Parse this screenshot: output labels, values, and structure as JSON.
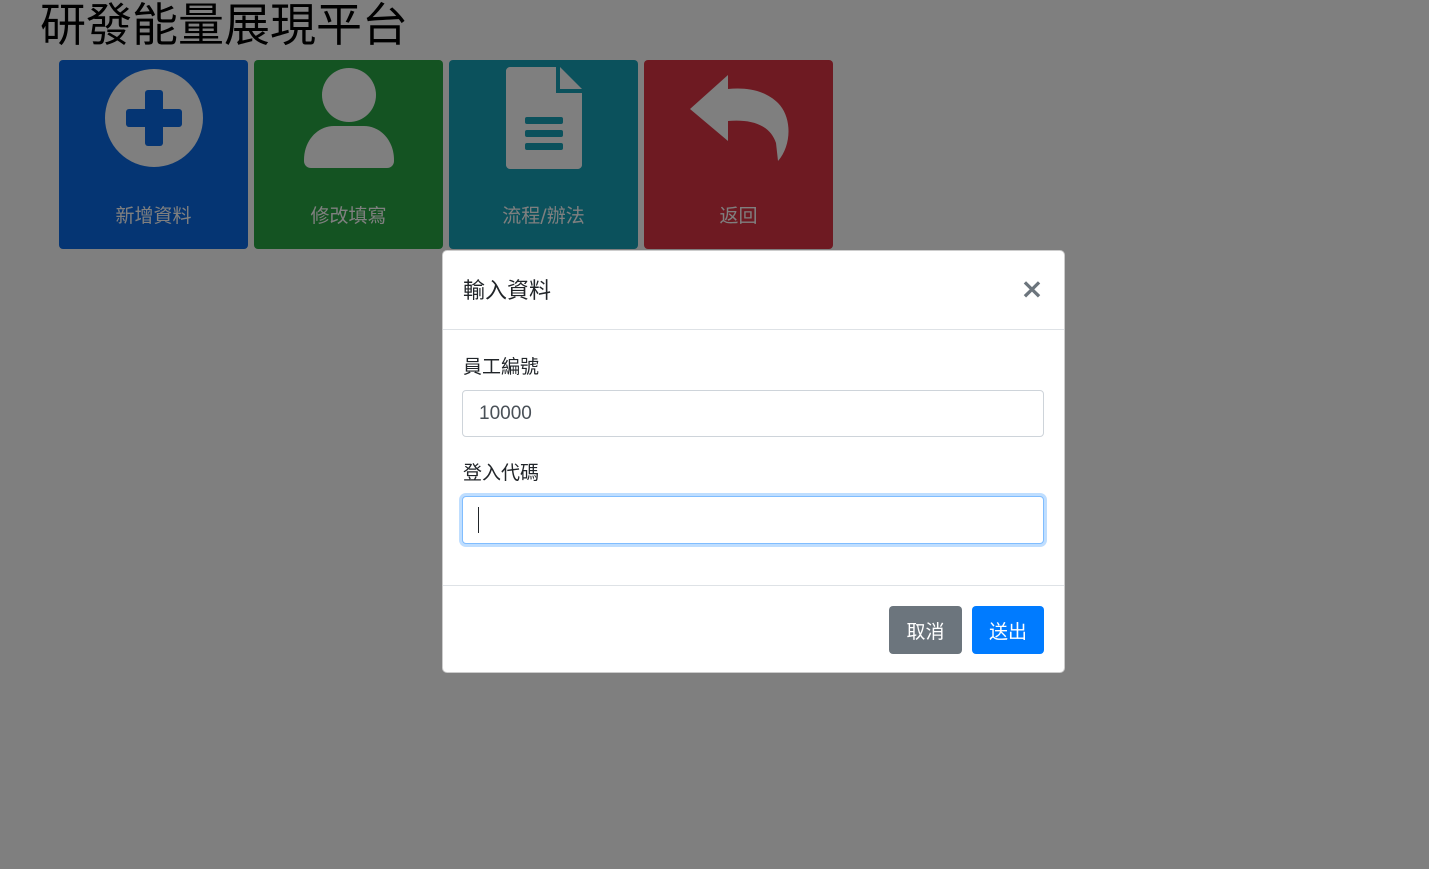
{
  "page": {
    "title": "研發能量展現平台"
  },
  "tiles": [
    {
      "label": "新增資料",
      "icon": "plus-circle-icon",
      "color": "#0a6ae6"
    },
    {
      "label": "修改填寫",
      "icon": "user-icon",
      "color": "#28a745"
    },
    {
      "label": "流程/辦法",
      "icon": "document-icon",
      "color": "#17a2b8"
    },
    {
      "label": "返回",
      "icon": "reply-arrow-icon",
      "color": "#dc3545"
    }
  ],
  "modal": {
    "title": "輸入資料",
    "close_label": "×",
    "fields": {
      "employee_id": {
        "label": "員工編號",
        "value": "10000"
      },
      "login_code": {
        "label": "登入代碼",
        "value": ""
      }
    },
    "buttons": {
      "cancel": "取消",
      "submit": "送出"
    }
  },
  "colors": {
    "primary": "#007bff",
    "secondary": "#6c757d",
    "backdrop_opacity": 0.5
  }
}
